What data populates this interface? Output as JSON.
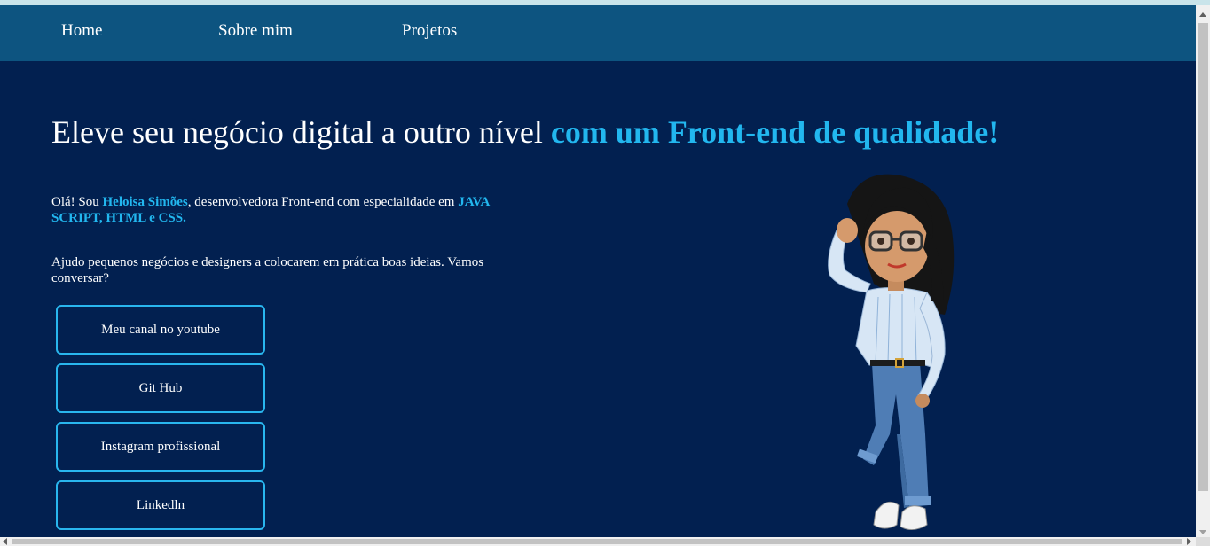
{
  "nav": {
    "items": [
      {
        "label": "Home"
      },
      {
        "label": "Sobre mim"
      },
      {
        "label": "Projetos"
      }
    ]
  },
  "hero": {
    "headline_plain": "Eleve seu negócio digital a outro nível ",
    "headline_highlight": "com um Front-end de qualidade!",
    "intro_part1": "Olá! Sou ",
    "intro_name": "Heloisa Simões",
    "intro_part2": ", desenvolvedora Front-end com especialidade em ",
    "intro_skills": "JAVA SCRIPT, HTML e CSS.",
    "intro2": "Ajudo pequenos negócios e designers a colocarem em prática boas ideias. Vamos conversar?"
  },
  "links": [
    {
      "label": "Meu canal no youtube"
    },
    {
      "label": "Git Hub"
    },
    {
      "label": "Instagram profissional"
    },
    {
      "label": "Linkedln"
    }
  ],
  "avatar": {
    "icon": "cartoon-woman-avatar"
  },
  "colors": {
    "background": "#022050",
    "navbar": "#0d5480",
    "accent": "#22b7ef"
  }
}
